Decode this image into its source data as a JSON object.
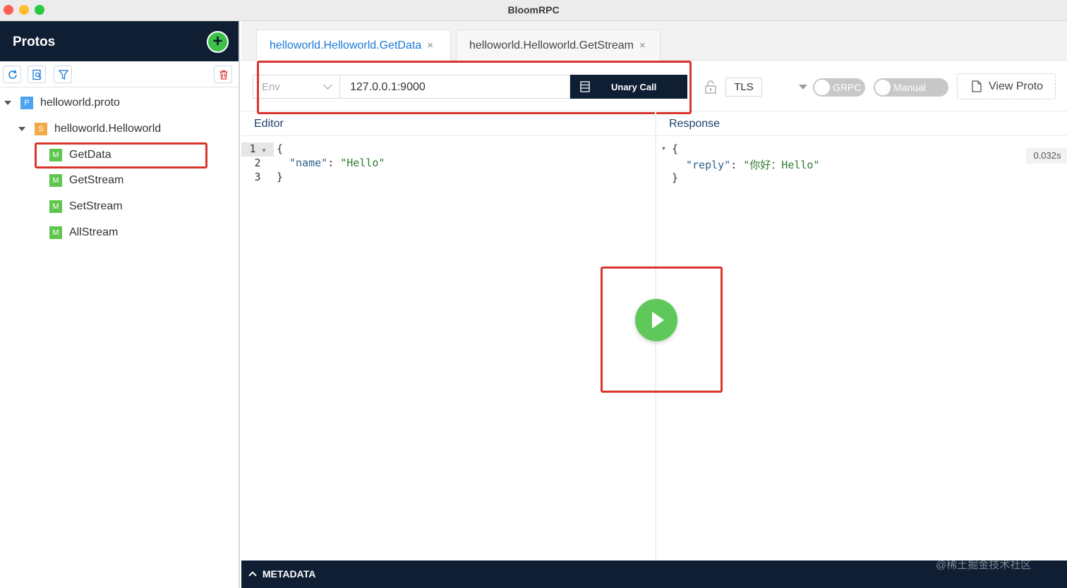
{
  "window": {
    "title": "BloomRPC"
  },
  "sidebar": {
    "title": "Protos",
    "add_label": "+",
    "tree": {
      "proto": {
        "badge": "P",
        "label": "helloworld.proto"
      },
      "service": {
        "badge": "S",
        "label": "helloworld.Helloworld"
      },
      "methods": [
        {
          "badge": "M",
          "label": "GetData"
        },
        {
          "badge": "M",
          "label": "GetStream"
        },
        {
          "badge": "M",
          "label": "SetStream"
        },
        {
          "badge": "M",
          "label": "AllStream"
        }
      ]
    }
  },
  "tabs": [
    {
      "label": "helloworld.Helloworld.GetData",
      "close": "×",
      "active": true
    },
    {
      "label": "helloworld.Helloworld.GetStream",
      "close": "×",
      "active": false
    }
  ],
  "request": {
    "env_placeholder": "Env",
    "url": "127.0.0.1:9000",
    "call_label": "Unary Call",
    "tls_label": "TLS",
    "grpc_label": "GRPC",
    "manual_label": "Manual",
    "view_proto_label": "View Proto"
  },
  "editor": {
    "title": "Editor",
    "lines": [
      "1",
      "2",
      "3"
    ],
    "open_brace": "{",
    "key": "\"name\"",
    "colon": ": ",
    "value": "\"Hello\"",
    "close_brace": "}"
  },
  "response": {
    "title": "Response",
    "open_brace": "{",
    "key": "\"reply\"",
    "colon": ": ",
    "value": "\"你好：Hello\"",
    "close_brace": "}",
    "elapsed": "0.032s"
  },
  "footer": {
    "metadata_label": "METADATA"
  },
  "watermark": "@稀土掘金技术社区",
  "colors": {
    "navy": "#0f1e33",
    "accent_blue": "#1a79d8",
    "green": "#5ec95a",
    "highlight_red": "#d9352d"
  },
  "icons": [
    "refresh-icon",
    "search-file-icon",
    "filter-icon",
    "trash-icon",
    "lock-icon",
    "document-icon",
    "play-icon"
  ]
}
